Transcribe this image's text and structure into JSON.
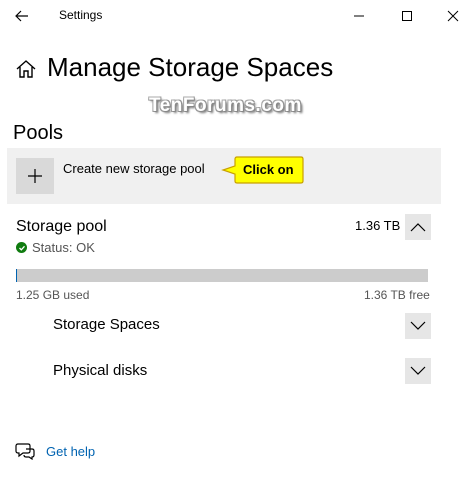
{
  "window": {
    "title": "Settings"
  },
  "header": {
    "title": "Manage Storage Spaces"
  },
  "watermark": "TenForums.com",
  "pools": {
    "section_title": "Pools",
    "create_label": "Create new storage pool",
    "callout": "Click on"
  },
  "pool": {
    "name": "Storage pool",
    "size": "1.36 TB",
    "status": "Status: OK",
    "used": "1.25 GB used",
    "free": "1.36 TB free",
    "usage_fraction": 0.001,
    "storage_spaces_label": "Storage Spaces",
    "physical_disks_label": "Physical disks"
  },
  "help": {
    "label": "Get help"
  },
  "colors": {
    "accent": "#0063b1",
    "status_ok": "#0f7b0f",
    "callout": "#ffff00"
  },
  "icons": [
    "back-arrow-icon",
    "minimize-icon",
    "maximize-icon",
    "close-icon",
    "home-icon",
    "plus-icon",
    "chevron-up-icon",
    "chevron-down-icon",
    "check-icon",
    "help-chat-icon"
  ]
}
